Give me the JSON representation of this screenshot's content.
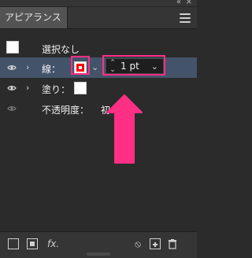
{
  "panel": {
    "tab_title": "アピアランス"
  },
  "rows": {
    "selection_label": "選択なし",
    "stroke": {
      "label": "線：",
      "weight_value": "1 pt"
    },
    "fill": {
      "label": "塗り："
    },
    "opacity": {
      "label": "不透明度：",
      "value_partial": "初"
    }
  },
  "colors": {
    "highlight": "#ff2f86",
    "stroke_swatch": "#ff0000",
    "selected_row": "#43546a"
  }
}
